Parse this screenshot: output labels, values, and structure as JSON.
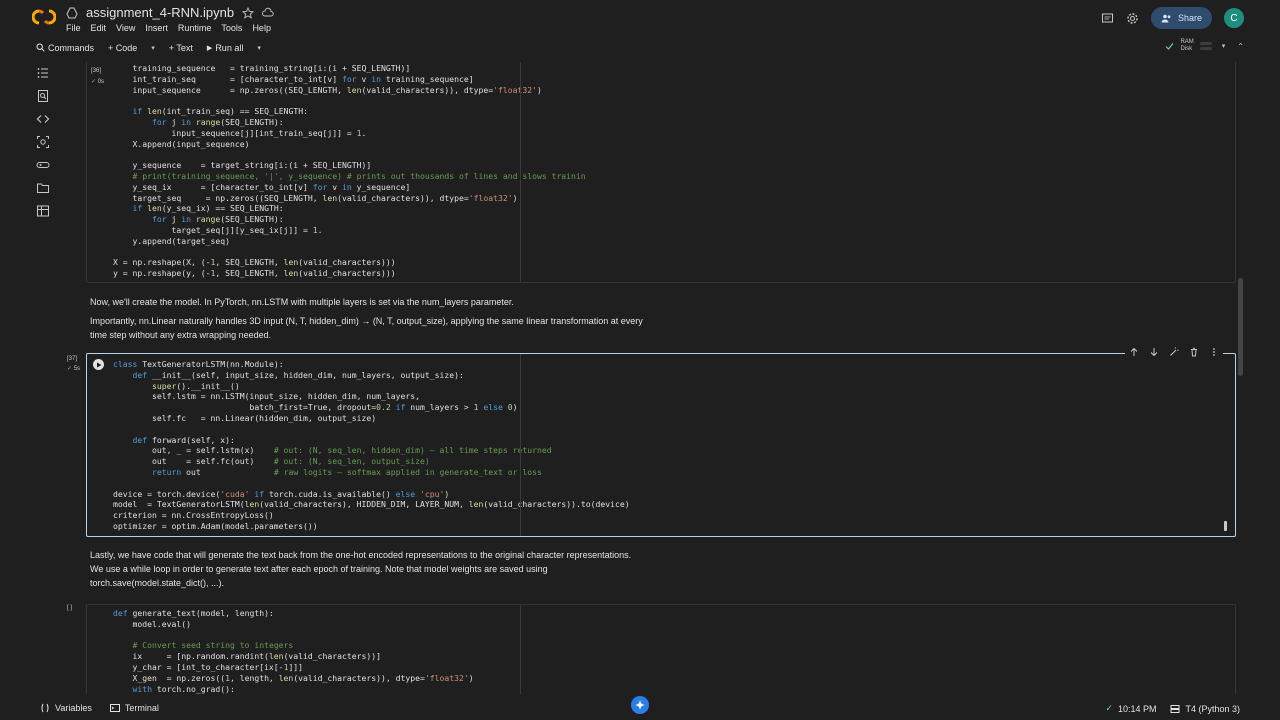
{
  "header": {
    "notebook_title": "assignment_4-RNN.ipynb",
    "menu": [
      "File",
      "Edit",
      "View",
      "Insert",
      "Runtime",
      "Tools",
      "Help"
    ],
    "share_label": "Share",
    "avatar_initial": "C"
  },
  "toolbar": {
    "commands_label": "Commands",
    "code_label": "+ Code",
    "text_label": "+ Text",
    "run_all_label": "Run all",
    "ram_label": "RAM",
    "disk_label": "Disk"
  },
  "cells": {
    "cell36": {
      "count": "[36]",
      "time": "0s",
      "lines": [
        "    training_sequence   = training_string[i:(i + SEQ_LENGTH)]",
        "    int_train_seq       = [character_to_int[v] for v in training_sequence]",
        "    input_sequence      = np.zeros((SEQ_LENGTH, len(valid_characters)), dtype='float32')",
        "",
        "    if len(int_train_seq) == SEQ_LENGTH:",
        "        for j in range(SEQ_LENGTH):",
        "            input_sequence[j][int_train_seq[j]] = 1.",
        "    X.append(input_sequence)",
        "",
        "    y_sequence    = target_string[i:(i + SEQ_LENGTH)]",
        "    # print(training_sequence, '|', y_sequence) # prints out thousands of lines and slows trainin",
        "    y_seq_ix      = [character_to_int[v] for v in y_sequence]",
        "    target_seq     = np.zeros((SEQ_LENGTH, len(valid_characters)), dtype='float32')",
        "    if len(y_seq_ix) == SEQ_LENGTH:",
        "        for j in range(SEQ_LENGTH):",
        "            target_seq[j][y_seq_ix[j]] = 1.",
        "    y.append(target_seq)",
        "",
        "X = np.reshape(X, (-1, SEQ_LENGTH, len(valid_characters)))",
        "y = np.reshape(y, (-1, SEQ_LENGTH, len(valid_characters)))"
      ]
    },
    "text1": {
      "p1": "Now, we'll create the model. In PyTorch, nn.LSTM with multiple layers is set via the num_layers parameter.",
      "p2a": "Importantly, nn.Linear naturally handles 3D input (N, T, hidden_dim) → (N, T, output_size), applying the same linear transformation at every",
      "p2b": "time step without any extra wrapping needed."
    },
    "cell37": {
      "count": "[37]",
      "time": "5s",
      "lines": [
        "class TextGeneratorLSTM(nn.Module):",
        "    def __init__(self, input_size, hidden_dim, num_layers, output_size):",
        "        super().__init__()",
        "        self.lstm = nn.LSTM(input_size, hidden_dim, num_layers,",
        "                            batch_first=True, dropout=0.2 if num_layers > 1 else 0)",
        "        self.fc   = nn.Linear(hidden_dim, output_size)",
        "",
        "    def forward(self, x):",
        "        out, _ = self.lstm(x)    # out: (N, seq_len, hidden_dim) — all time steps returned",
        "        out    = self.fc(out)    # out: (N, seq_len, output_size)",
        "        return out               # raw logits — softmax applied in generate_text or loss",
        "",
        "device = torch.device('cuda' if torch.cuda.is_available() else 'cpu')",
        "model  = TextGeneratorLSTM(len(valid_characters), HIDDEN_DIM, LAYER_NUM, len(valid_characters)).to(device)",
        "criterion = nn.CrossEntropyLoss()",
        "optimizer = optim.Adam(model.parameters())"
      ]
    },
    "text2": {
      "l1": "Lastly, we have code that will generate the text back from the one-hot encoded representations to the original character representations.",
      "l2": "We use a while loop in order to generate text after each epoch of training. Note that model weights are saved using",
      "l3": "torch.save(model.state_dict(), ...)."
    },
    "cell38": {
      "count": "[ ]",
      "lines": [
        "def generate_text(model, length):",
        "    model.eval()",
        "",
        "    # Convert seed string to integers",
        "    ix     = [np.random.randint(len(valid_characters))]",
        "    y_char = [int_to_character[ix[-1]]]",
        "    X_gen  = np.zeros((1, length, len(valid_characters)), dtype='float32')",
        "    with torch.no_grad():"
      ]
    }
  },
  "status": {
    "variables_label": "Variables",
    "terminal_label": "Terminal",
    "time": "10:14 PM",
    "runtime": "T4 (Python 3)"
  }
}
